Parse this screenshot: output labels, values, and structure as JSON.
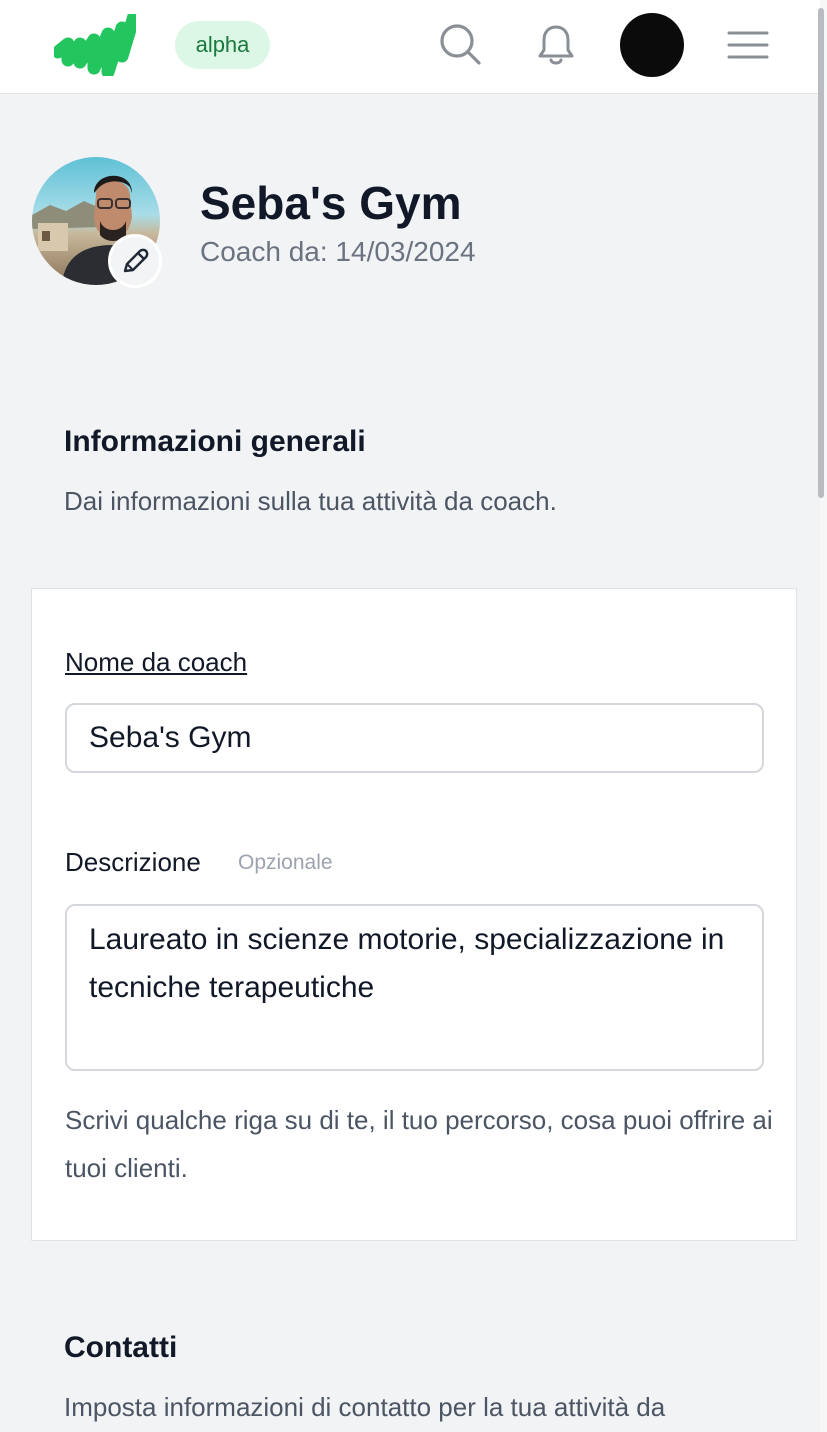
{
  "header": {
    "badge": "alpha",
    "icons": {
      "logo": "brand-logo-icon",
      "search": "search-icon",
      "notifications": "bell-icon",
      "avatar": "avatar",
      "menu": "hamburger-menu-icon"
    },
    "brand_color": "#22c55e"
  },
  "profile": {
    "name": "Seba's Gym",
    "since": "Coach da: 14/03/2024",
    "edit_icon": "pencil-icon"
  },
  "general_info": {
    "title": "Informazioni generali",
    "description": "Dai informazioni sulla tua attività da coach.",
    "coach_name": {
      "label": "Nome da coach",
      "value": "Seba's Gym"
    },
    "bio": {
      "label": "Descrizione",
      "optional": "Opzionale",
      "value": "Laureato in scienze motorie, specializzazione in tecniche terapeutiche",
      "help": "Scrivi qualche riga su di te, il tuo percorso, cosa puoi offrire ai tuoi clienti."
    }
  },
  "contacts": {
    "title": "Contatti",
    "description": "Imposta informazioni di contatto per la tua attività da"
  }
}
